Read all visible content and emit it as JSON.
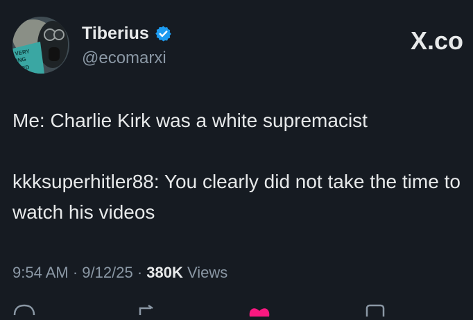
{
  "brand": {
    "label": "X.co"
  },
  "author": {
    "name": "Tiberius",
    "handle": "@ecomarxi",
    "avatar_text": [
      "VERY",
      "ING",
      "KED"
    ]
  },
  "tweet": {
    "line1": "Me: Charlie Kirk was a white supremacist",
    "line2": "kkksuperhitler88: You clearly did not take the time to watch his videos"
  },
  "meta": {
    "time": "9:54 AM",
    "date": "9/12/25",
    "views_count": "380K",
    "views_label": "Views",
    "separator": "·"
  },
  "icons": {
    "verified": "verified-badge-icon",
    "reply": "reply-icon",
    "like": "heart-icon",
    "bookmark": "bookmark-icon"
  },
  "colors": {
    "background": "#161b22",
    "verified": "#1d9bf0",
    "like": "#f91880",
    "muted": "#8b98a5"
  }
}
